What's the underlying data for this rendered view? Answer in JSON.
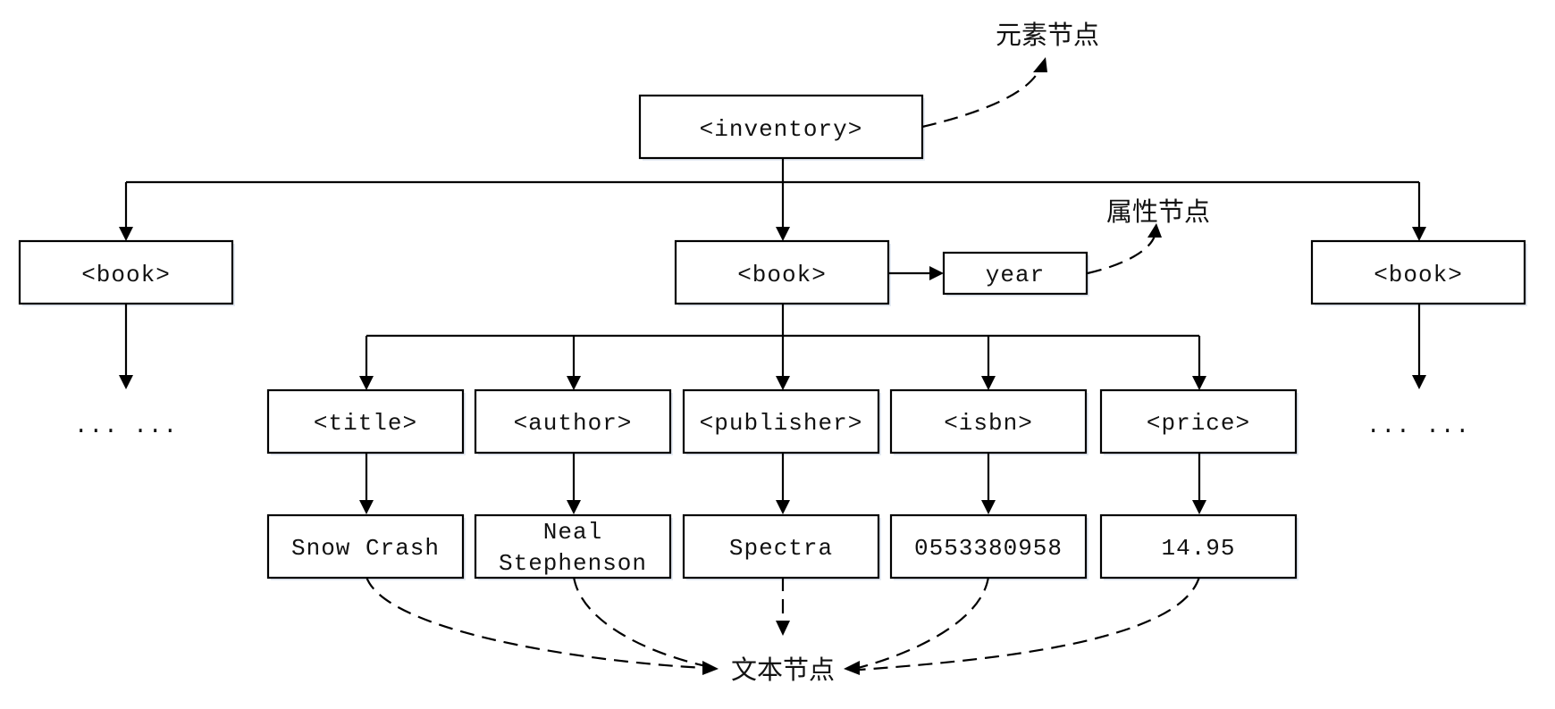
{
  "nodes": {
    "root": "<inventory>",
    "book_left": "<book>",
    "book_center": "<book>",
    "book_right": "<book>",
    "attribute": "year",
    "children": [
      "<title>",
      "<author>",
      "<publisher>",
      "<isbn>",
      "<price>"
    ],
    "values": [
      [
        "Snow Crash"
      ],
      [
        "Neal",
        "Stephenson"
      ],
      [
        "Spectra"
      ],
      [
        "0553380958"
      ],
      [
        "14.95"
      ]
    ],
    "ellipsis_left": "... ...",
    "ellipsis_right": "... ..."
  },
  "annotations": {
    "element_node": "元素节点",
    "attribute_node": "属性节点",
    "text_node": "文本节点"
  }
}
